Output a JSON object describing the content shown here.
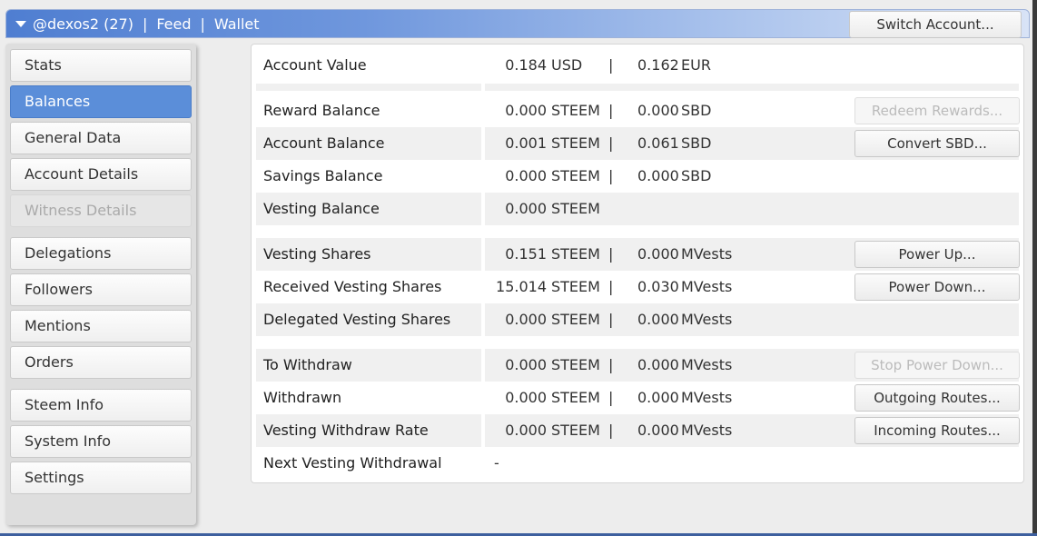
{
  "header": {
    "account": "@dexos2 (27)",
    "separator": "|",
    "links": [
      "Feed",
      "Wallet"
    ],
    "switch_label": "Switch Account..."
  },
  "sidebar": {
    "items": [
      {
        "label": "Stats",
        "state": "normal"
      },
      {
        "label": "Balances",
        "state": "active"
      },
      {
        "label": "General Data",
        "state": "normal"
      },
      {
        "label": "Account Details",
        "state": "normal"
      },
      {
        "label": "Witness Details",
        "state": "disabled"
      },
      {
        "label": "Delegations",
        "state": "normal"
      },
      {
        "label": "Followers",
        "state": "normal"
      },
      {
        "label": "Mentions",
        "state": "normal"
      },
      {
        "label": "Orders",
        "state": "normal"
      },
      {
        "label": "Steem Info",
        "state": "normal"
      },
      {
        "label": "System Info",
        "state": "normal"
      },
      {
        "label": "Settings",
        "state": "normal"
      }
    ]
  },
  "balances": {
    "rows": [
      {
        "label": "Account Value",
        "v1": "0.184",
        "u1": "USD",
        "v2": "0.162",
        "u2": "EUR"
      },
      {
        "label": "Reward Balance",
        "v1": "0.000",
        "u1": "STEEM",
        "v2": "0.000",
        "u2": "SBD",
        "button": "Redeem Rewards...",
        "button_disabled": true
      },
      {
        "label": "Account Balance",
        "v1": "0.001",
        "u1": "STEEM",
        "v2": "0.061",
        "u2": "SBD",
        "button": "Convert SBD..."
      },
      {
        "label": "Savings Balance",
        "v1": "0.000",
        "u1": "STEEM",
        "v2": "0.000",
        "u2": "SBD"
      },
      {
        "label": "Vesting Balance",
        "v1": "0.000",
        "u1": "STEEM"
      },
      {
        "label": "Vesting Shares",
        "v1": "0.151",
        "u1": "STEEM",
        "v2": "0.000",
        "u2": "MVests",
        "button": "Power Up..."
      },
      {
        "label": "Received Vesting Shares",
        "v1": "15.014",
        "u1": "STEEM",
        "v2": "0.030",
        "u2": "MVests",
        "button": "Power Down..."
      },
      {
        "label": "Delegated Vesting Shares",
        "v1": "0.000",
        "u1": "STEEM",
        "v2": "0.000",
        "u2": "MVests"
      },
      {
        "label": "To Withdraw",
        "v1": "0.000",
        "u1": "STEEM",
        "v2": "0.000",
        "u2": "MVests",
        "button": "Stop Power Down...",
        "button_disabled": true
      },
      {
        "label": "Withdrawn",
        "v1": "0.000",
        "u1": "STEEM",
        "v2": "0.000",
        "u2": "MVests",
        "button": "Outgoing Routes..."
      },
      {
        "label": "Vesting Withdraw Rate",
        "v1": "0.000",
        "u1": "STEEM",
        "v2": "0.000",
        "u2": "MVests",
        "button": "Incoming Routes..."
      },
      {
        "label": "Next Vesting Withdrawal",
        "value": "-"
      }
    ]
  }
}
